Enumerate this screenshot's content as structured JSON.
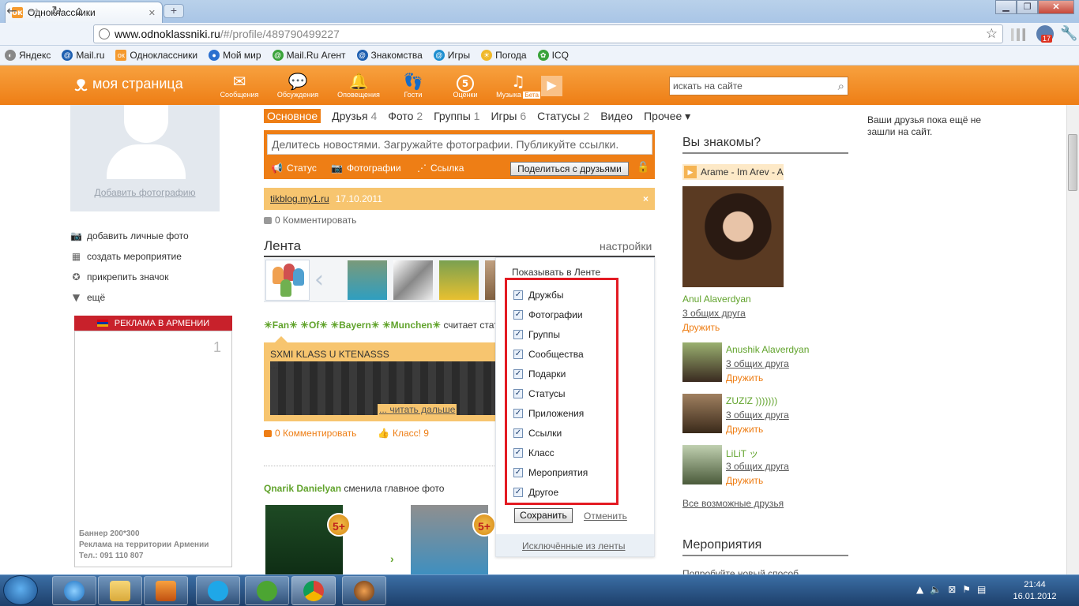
{
  "browser": {
    "tab_title": "Одноклассники",
    "tab_close": "✕",
    "new_tab": "+",
    "url_host": "www.odnoklassniki.ru",
    "url_path": "/#/profile/489790499227",
    "bookmarks": [
      "Яндекс",
      "Mail.ru",
      "Одноклассники",
      "Мой мир",
      "Mail.Ru Агент",
      "Знакомства",
      "Игры",
      "Погода",
      "ICQ"
    ],
    "ext_badge": "17"
  },
  "header": {
    "logo_text": "моя страница",
    "nav": [
      {
        "label": "Сообщения",
        "icon": "envelope-icon"
      },
      {
        "label": "Обсуждения",
        "icon": "speech-bubbles-icon"
      },
      {
        "label": "Оповещения",
        "icon": "bell-icon"
      },
      {
        "label": "Гости",
        "icon": "footprints-icon"
      },
      {
        "label": "Оценки",
        "icon": "rating-icon",
        "badge": "5"
      },
      {
        "label": "Музыка",
        "icon": "music-note-icon",
        "tag": "Бета"
      }
    ],
    "search_placeholder": "искать на сайте"
  },
  "left": {
    "add_photo": "Добавить фотографию",
    "actions": [
      "добавить личные фото",
      "создать мероприятие",
      "прикрепить значок",
      "ещё"
    ],
    "ad_header": "РЕКЛАМА В АРМЕНИИ",
    "ad_number": "1",
    "ad_text_1": "Баннер 200*300",
    "ad_text_2": "Реклама на территории Армении",
    "ad_text_3": "Тел.: 091 110 807"
  },
  "subnav": [
    {
      "label": "Основное",
      "count": ""
    },
    {
      "label": "Друзья",
      "count": "4"
    },
    {
      "label": "Фото",
      "count": "2"
    },
    {
      "label": "Группы",
      "count": "1"
    },
    {
      "label": "Игры",
      "count": "6"
    },
    {
      "label": "Статусы",
      "count": "2"
    },
    {
      "label": "Видео",
      "count": ""
    },
    {
      "label": "Прочее ▾",
      "count": ""
    }
  ],
  "compose": {
    "placeholder": "Делитесь новостями. Загружайте фотографии. Публикуйте ссылки.",
    "status": "Статус",
    "photos": "Фотографии",
    "link": "Ссылка",
    "share": "Поделиться с друзьями"
  },
  "notice": {
    "link": "tikblog.my1.ru",
    "date": "17.10.2011",
    "close": "×"
  },
  "comment_1": "0 Комментировать",
  "feed": {
    "title": "Лента",
    "settings": "настройки",
    "post1_name": "☀Fan☀ ☀Of☀ ☀Bayern☀ ☀Munchen☀",
    "post1_action": "считает стат",
    "status_title": "SXMI KLASS U KTENASSS",
    "status_dots": "...",
    "read_more": "... читать дальше",
    "comment_2": "0 Комментировать",
    "like": "Класс! 9",
    "post2_name": "Qnarik Danielyan",
    "post2_action": "сменила главное фото",
    "badge": "5+"
  },
  "popup": {
    "title": "Показывать в Ленте",
    "options": [
      {
        "label": "Дружбы",
        "checked": true
      },
      {
        "label": "Фотографии",
        "checked": true
      },
      {
        "label": "Группы",
        "checked": true
      },
      {
        "label": "Сообщества",
        "checked": true
      },
      {
        "label": "Подарки",
        "checked": true
      },
      {
        "label": "Статусы",
        "checked": true
      },
      {
        "label": "Приложения",
        "checked": true
      },
      {
        "label": "Ссылки",
        "checked": true
      },
      {
        "label": "Класс",
        "checked": true
      },
      {
        "label": "Мероприятия",
        "checked": true
      },
      {
        "label": "Другое",
        "checked": true
      }
    ],
    "save": "Сохранить",
    "cancel": "Отменить",
    "excluded": "Исключённые из ленты"
  },
  "right": {
    "title": "Вы знакомы?",
    "music": "Arame - Im Arev - A",
    "friends": [
      {
        "name": "Anul Alaverdyan",
        "common": "3 общих друга",
        "add": "Дружить"
      },
      {
        "name": "Anushik Alaverdyan",
        "common": "3 общих друга",
        "add": "Дружить"
      },
      {
        "name": "ZUZIZ )))))))",
        "common": "3 общих друга",
        "add": "Дружить"
      },
      {
        "name": "LiLiT ッ",
        "common": "3 общих друга",
        "add": "Дружить"
      }
    ],
    "all_friends": "Все возможные друзья",
    "events_title": "Мероприятия",
    "events_more": "Попробуйте новый способ",
    "friends_note": "Ваши друзья пока ещё не зашли на сайт."
  },
  "taskbar": {
    "time": "21:44",
    "date": "16.01.2012"
  }
}
